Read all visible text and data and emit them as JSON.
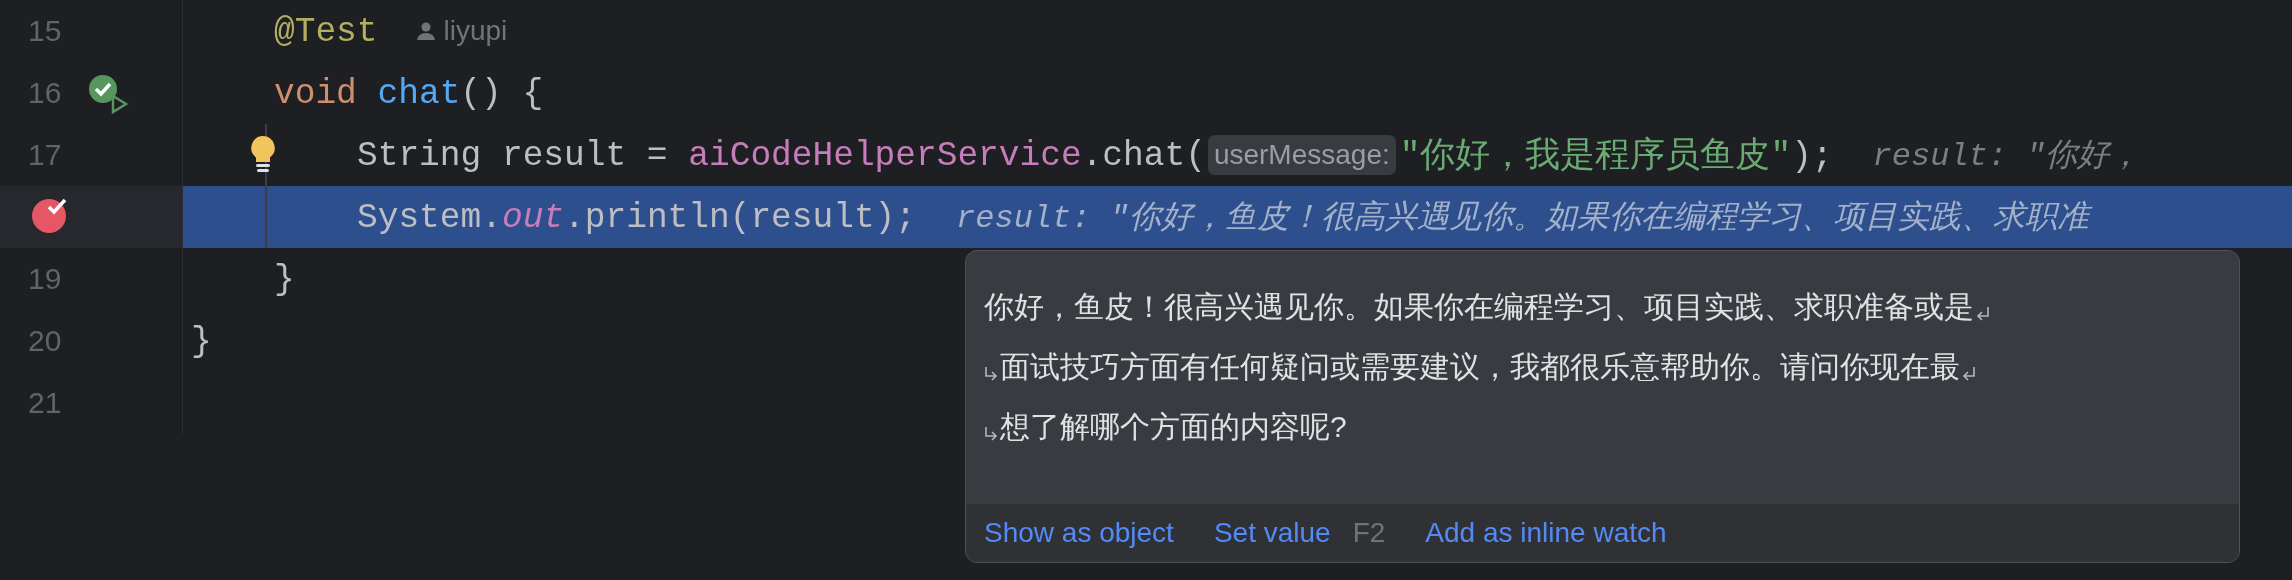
{
  "editor": {
    "lines": [
      {
        "kind": "block",
        "children": [
          {
            "kind": "line",
            "number": "15",
            "current": false,
            "tokens": [
              {
                "kind": "annotation",
                "text": "@Test"
              },
              {
                "kind": "author",
                "text": "liyupi"
              }
            ]
          },
          {
            "kind": "line",
            "number": "16",
            "icon": {
              "kind": "run-test"
            },
            "current": false,
            "tokens": [
              {
                "kind": "keyword",
                "text": "void "
              },
              {
                "kind": "function",
                "text": "chat"
              },
              {
                "kind": "plain",
                "text": "() {"
              }
            ],
            "children": [
              {
                "kind": "line",
                "number": "17",
                "icon": {
                  "kind": "intention"
                },
                "current": false,
                "tokens": [
                  {
                    "kind": "plain",
                    "text": "String result = "
                  },
                  {
                    "kind": "field",
                    "text": "aiCodeHelperService"
                  },
                  {
                    "kind": "plain",
                    "text": ".chat("
                  },
                  {
                    "kind": "param_hint",
                    "text": "userMessage:"
                  },
                  {
                    "kind": "string",
                    "text": "\"你好，我是程序员鱼皮\""
                  },
                  {
                    "kind": "plain",
                    "text": ");"
                  },
                  {
                    "kind": "value_hint",
                    "text": "result: \"你好，"
                  }
                ]
              },
              {
                "kind": "line",
                "icon": {
                  "kind": "breakpoint"
                },
                "current": true,
                "tokens": [
                  {
                    "kind": "plain",
                    "text": "System."
                  },
                  {
                    "kind": "static",
                    "text": "out"
                  },
                  {
                    "kind": "plain",
                    "text": ".println(result);"
                  },
                  {
                    "kind": "value_hint",
                    "text": "result: \"你好，鱼皮！很高兴遇见你。如果你在编程学习、项目实践、求职准"
                  }
                ]
              }
            ]
          },
          {
            "kind": "line",
            "number": "19",
            "current": false,
            "tokens": [
              {
                "kind": "plain",
                "text": "}"
              }
            ]
          }
        ]
      },
      {
        "kind": "line",
        "number": "20",
        "current": false,
        "tokens": [
          {
            "kind": "plain",
            "text": "}"
          }
        ]
      },
      {
        "kind": "line",
        "number": "21",
        "current": false
      }
    ]
  },
  "value_popup": {
    "lines": [
      "你好，鱼皮！很高兴遇见你。如果你在编程学习、项目实践、求职准备或是",
      "面试技巧方面有任何疑问或需要建议，我都很乐意帮助你。请问你现在最",
      "想了解哪个方面的内容呢?"
    ],
    "actions": [
      {
        "label": "Show as object"
      },
      {
        "label": "Set value",
        "shortcut": "F2"
      },
      {
        "label": "Add as inline watch"
      }
    ]
  }
}
